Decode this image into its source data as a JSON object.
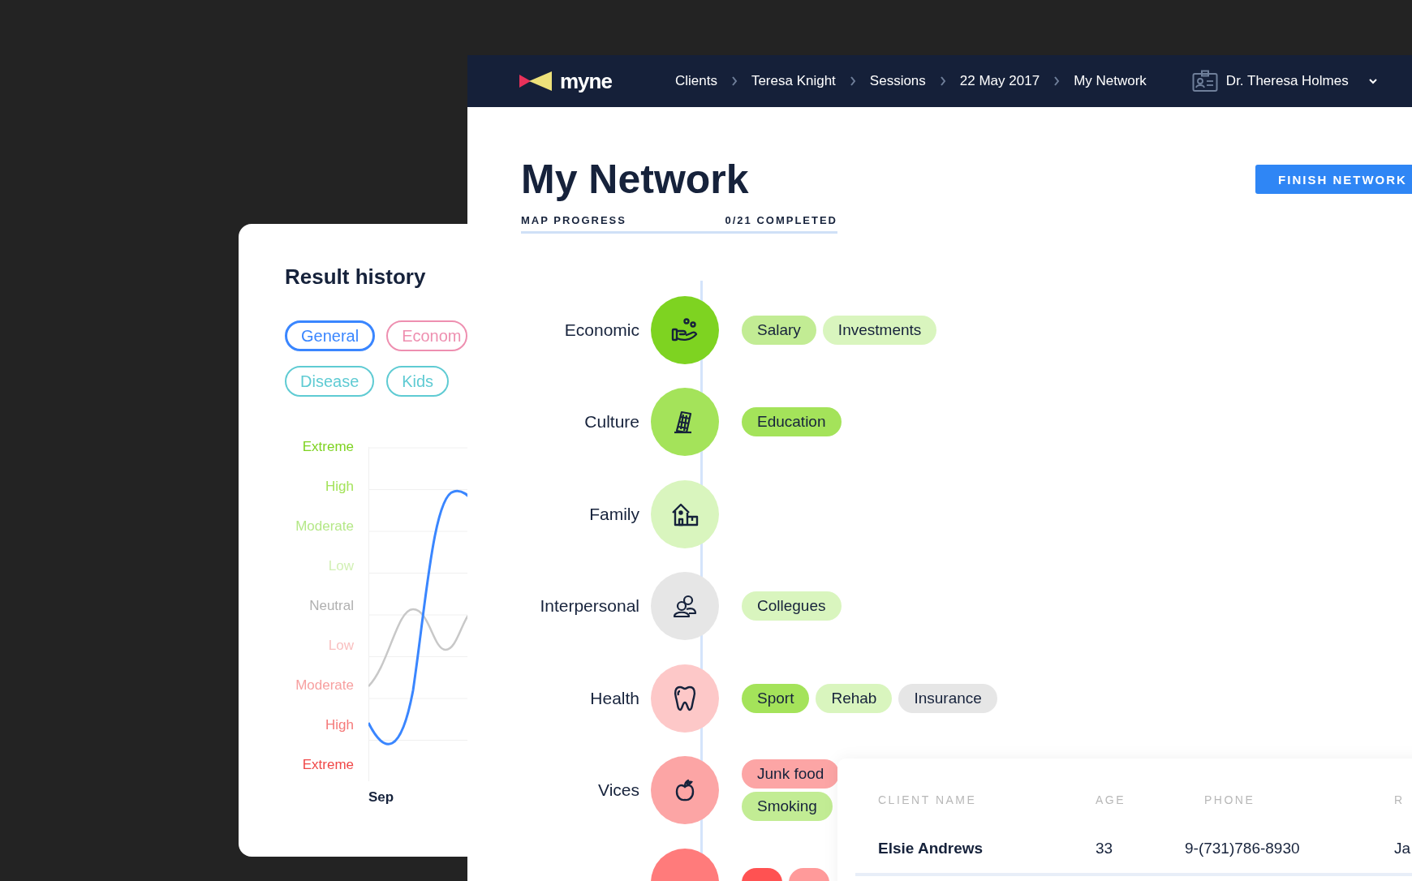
{
  "result_history": {
    "title": "Result history",
    "filters": [
      {
        "label": "General",
        "selected": true,
        "color": "#3a86ff"
      },
      {
        "label": "Econom",
        "selected": false,
        "color": "#ee8fb0"
      },
      {
        "label": "Disease",
        "selected": false,
        "color": "#5fcbd3"
      },
      {
        "label": "Kids",
        "selected": false,
        "color": "#5fcbd3"
      }
    ],
    "levels": [
      {
        "label": "Extreme",
        "color": "#7ed321"
      },
      {
        "label": "High",
        "color": "#a4e35a"
      },
      {
        "label": "Moderate",
        "color": "#b5e888"
      },
      {
        "label": "Low",
        "color": "#d2f0b5"
      },
      {
        "label": "Neutral",
        "color": "#b0b0b0"
      },
      {
        "label": "Low",
        "color": "#f9c0c0"
      },
      {
        "label": "Moderate",
        "color": "#f7a0a0"
      },
      {
        "label": "High",
        "color": "#f57a7a"
      },
      {
        "label": "Extreme",
        "color": "#f04848"
      }
    ],
    "x_label": "Sep"
  },
  "header": {
    "logo": "myne",
    "breadcrumbs": [
      "Clients",
      "Teresa Knight",
      "Sessions",
      "22 May 2017",
      "My Network"
    ],
    "user": "Dr. Theresa Holmes"
  },
  "page": {
    "title": "My Network",
    "button": "FINISH NETWORK",
    "progress": {
      "label": "MAP PROGRESS",
      "count": "0/21 COMPLETED",
      "level": 0
    }
  },
  "network": [
    {
      "label": "Economic",
      "kind": "hand",
      "color": "#7ed321",
      "tag_rows": [
        [
          {
            "label": "Salary",
            "color": "#c2ec94"
          },
          {
            "label": "Investments",
            "color": "#d9f5be"
          }
        ]
      ]
    },
    {
      "label": "Culture",
      "kind": "tower",
      "color": "#a4e35a",
      "tag_rows": [
        [
          {
            "label": "Education",
            "color": "#a4e35a"
          }
        ]
      ]
    },
    {
      "label": "Family",
      "kind": "house",
      "color": "#d9f5be"
    },
    {
      "label": "Interpersonal",
      "kind": "people",
      "color": "#e6e6e6",
      "tag_rows": [
        [
          {
            "label": "Collegues",
            "color": "#d9f5be"
          }
        ]
      ]
    },
    {
      "label": "Health",
      "kind": "tooth",
      "color": "#fdc8c8",
      "tag_rows": [
        [
          {
            "label": "Sport",
            "color": "#a4e35a"
          },
          {
            "label": "Rehab",
            "color": "#d9f5be"
          },
          {
            "label": "Insurance",
            "color": "#e6e6e6"
          }
        ]
      ]
    },
    {
      "label": "Vices",
      "kind": "apple",
      "color": "#fca5a5",
      "tag_rows": [
        [
          {
            "label": "Junk food",
            "color": "#fca5a5"
          }
        ],
        [
          {
            "label": "Smoking",
            "color": "#c2ec94"
          }
        ]
      ]
    },
    {
      "kind": "partial",
      "color": "#ff7b7b",
      "partial_tags": [
        {
          "color": "#ff5252"
        },
        {
          "color": "#ff9a9a"
        }
      ]
    }
  ],
  "clients_table": {
    "columns": [
      "CLIENT NAME",
      "AGE",
      "PHONE",
      "R"
    ],
    "rows": [
      [
        "Elsie Andrews",
        "33",
        "9-(731)786-8930",
        "Ja"
      ]
    ]
  }
}
